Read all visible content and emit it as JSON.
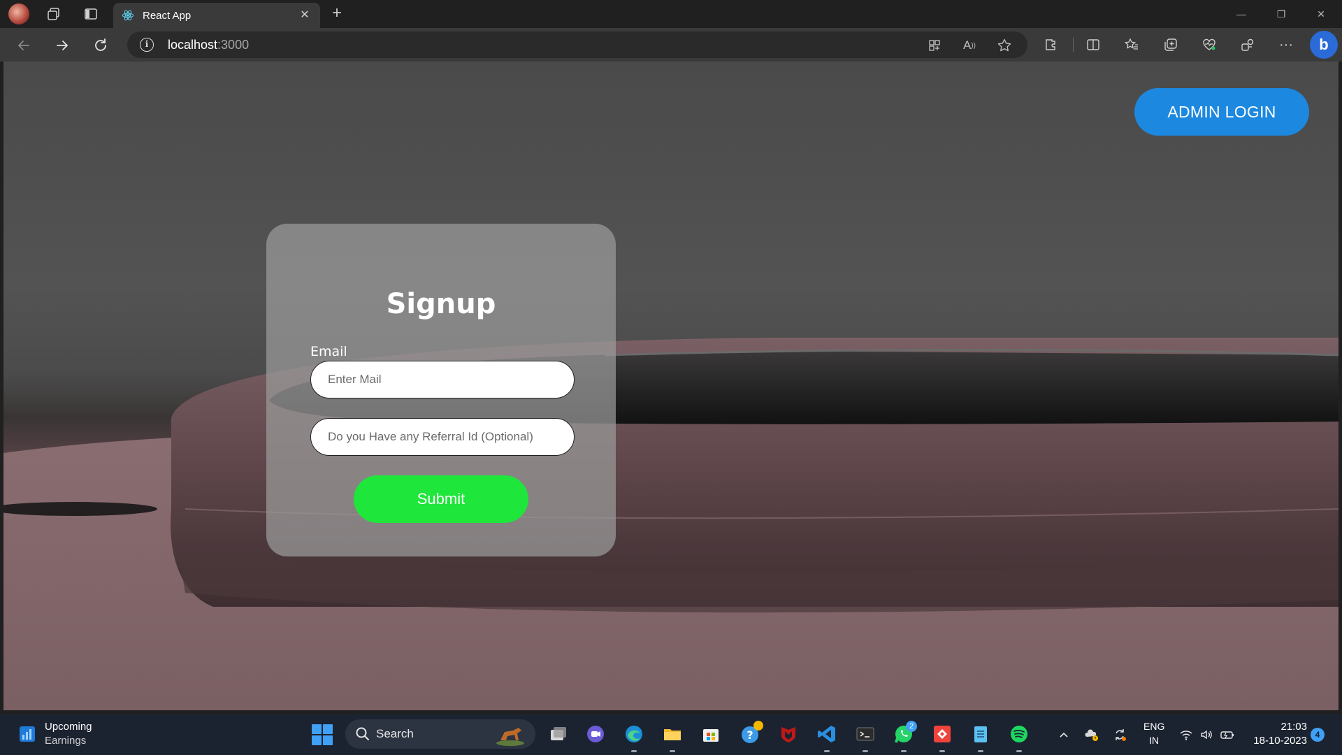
{
  "browser": {
    "tab_title": "React App",
    "url_host": "localhost",
    "url_port": ":3000",
    "icons": [
      "profile-avatar",
      "workspaces-icon",
      "tab-actions-icon",
      "react-favicon",
      "close-icon",
      "plus-icon",
      "minimize-icon",
      "restore-icon",
      "close-window-icon",
      "back-icon",
      "forward-icon",
      "refresh-icon",
      "site-info-icon",
      "app-available-icon",
      "read-aloud-icon",
      "favorite-star-icon",
      "extensions-icon",
      "split-screen-icon",
      "favorites-icon",
      "collections-icon",
      "browser-essentials-icon",
      "share-icon",
      "more-icon",
      "bing-copilot-icon"
    ]
  },
  "page": {
    "admin_button": "ADMIN LOGIN",
    "form": {
      "title": "Signup",
      "email_label": "Email",
      "email_placeholder": "Enter Mail",
      "referral_placeholder": "Do you Have any Referral Id (Optional)",
      "submit_label": "Submit"
    },
    "colors": {
      "admin_button": "#1d88df",
      "submit_button": "#1ee63a"
    }
  },
  "taskbar": {
    "widget_title": "Upcoming",
    "widget_subtitle": "Earnings",
    "search_label": "Search",
    "whatsapp_badge": "2",
    "lang_primary": "ENG",
    "lang_secondary": "IN",
    "time": "21:03",
    "date": "18-10-2023",
    "notification_count": "4",
    "apps": [
      "start-icon",
      "task-view-icon",
      "teams-chat-icon",
      "edge-icon",
      "file-explorer-icon",
      "ms-store-icon",
      "get-help-icon",
      "mcafee-icon",
      "vscode-icon",
      "terminal-icon",
      "whatsapp-icon",
      "anydesk-icon",
      "notepad-icon",
      "spotify-icon"
    ]
  }
}
